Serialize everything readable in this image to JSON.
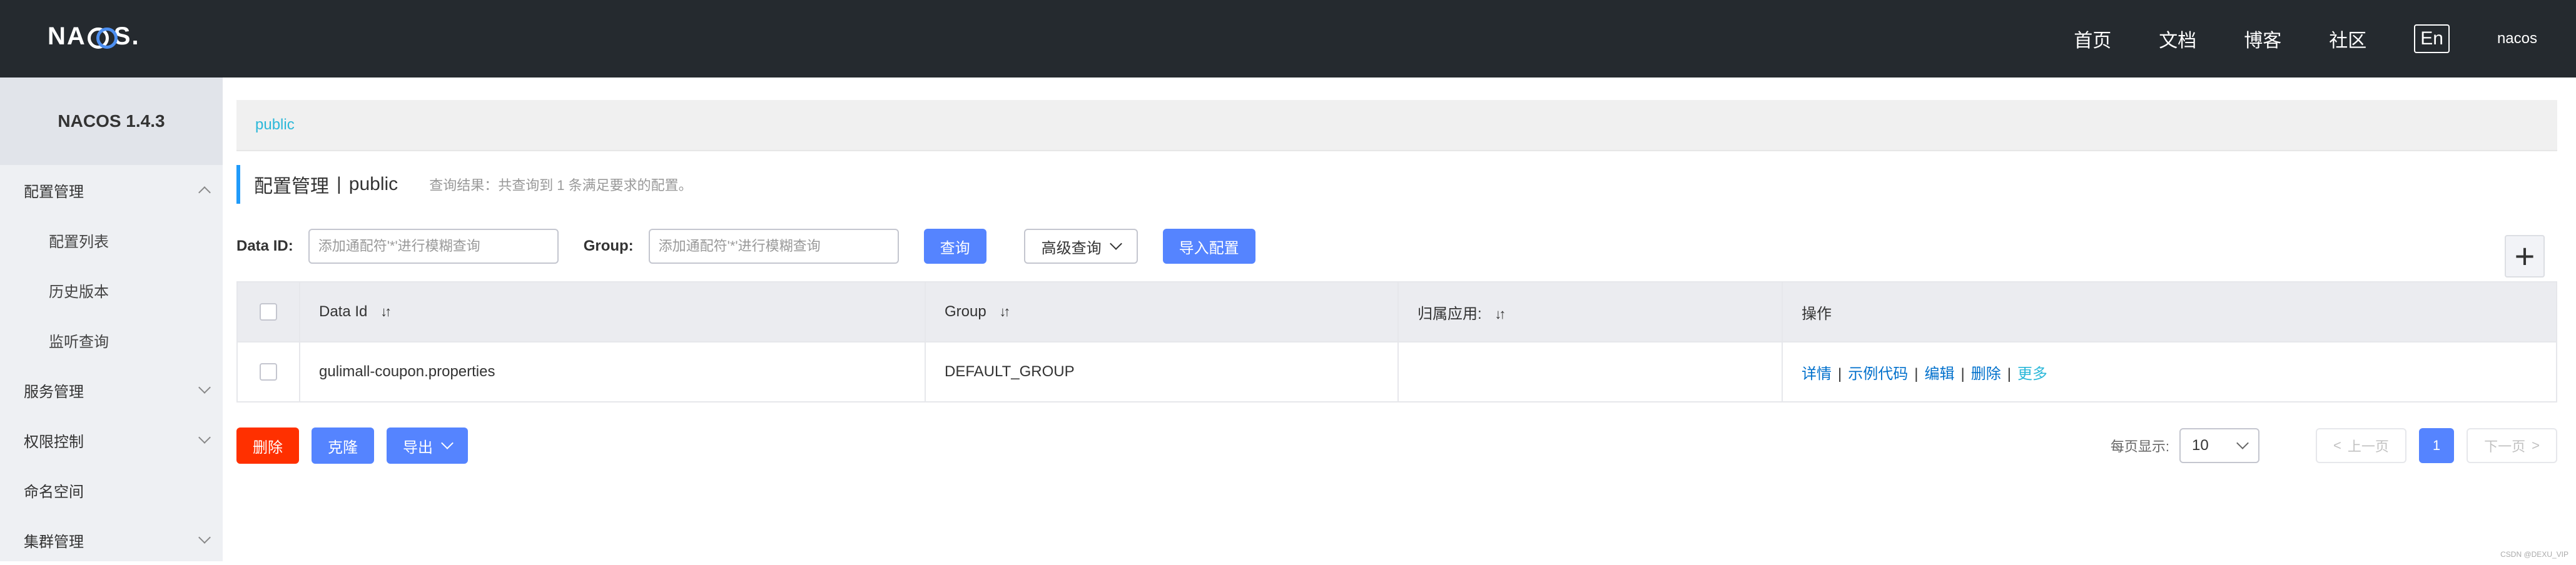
{
  "header": {
    "logo": {
      "pre": "NA",
      "post": "S",
      "dot": "."
    },
    "nav": [
      "首页",
      "文档",
      "博客",
      "社区"
    ],
    "language": "En",
    "user": "nacos"
  },
  "sidebar": {
    "version": "NACOS 1.4.3",
    "items": [
      {
        "label": "配置管理",
        "expanded": true
      },
      {
        "label": "配置列表"
      },
      {
        "label": "历史版本"
      },
      {
        "label": "监听查询"
      },
      {
        "label": "服务管理"
      },
      {
        "label": "权限控制"
      },
      {
        "label": "命名空间"
      },
      {
        "label": "集群管理"
      }
    ]
  },
  "namespace": {
    "current": "public"
  },
  "title": {
    "main": "配置管理",
    "separator": "|",
    "namespace": "public",
    "query_result": "查询结果：共查询到 1 条满足要求的配置。"
  },
  "search": {
    "data_id_label": "Data ID:",
    "data_id_placeholder": "添加通配符'*'进行模糊查询",
    "group_label": "Group:",
    "group_placeholder": "添加通配符'*'进行模糊查询",
    "query_button": "查询",
    "advanced_button": "高级查询",
    "import_button": "导入配置",
    "add_button": "+"
  },
  "table": {
    "columns": [
      "Data Id",
      "Group",
      "归属应用:",
      "操作"
    ],
    "rows": [
      {
        "data_id": "gulimall-coupon.properties",
        "group": "DEFAULT_GROUP",
        "app": "",
        "actions": [
          "详情",
          "示例代码",
          "编辑",
          "删除",
          "更多"
        ]
      }
    ]
  },
  "batch": {
    "delete": "删除",
    "clone": "克隆",
    "export": "导出"
  },
  "pagination": {
    "page_size_label": "每页显示:",
    "page_size": "10",
    "prev": "上一页",
    "current": "1",
    "next": "下一页"
  },
  "watermark": "CSDN @DEXU_VIP",
  "colors": {
    "header_bg": "#252a2f",
    "primary": "#5584ff",
    "danger": "#ff3000",
    "link": "#0070cc",
    "accent": "#2bb8d9"
  }
}
